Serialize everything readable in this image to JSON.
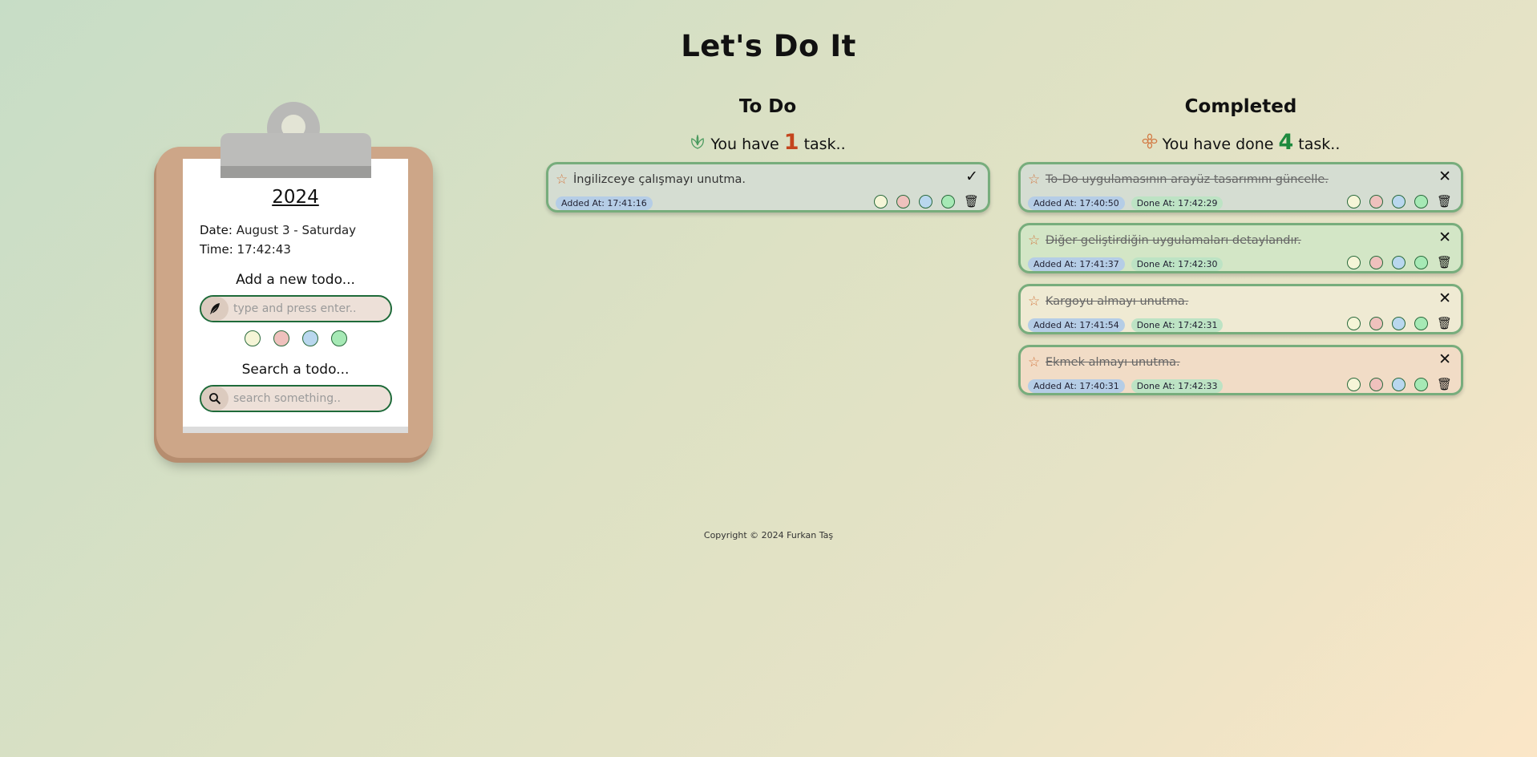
{
  "page": {
    "title": "Let's Do It"
  },
  "sidebar": {
    "year": "2024",
    "date_label": "Date:",
    "date_value": "August 3 - Saturday",
    "time_label": "Time:",
    "time_value": "17:42:43",
    "add_label": "Add a new todo...",
    "add_placeholder": "type and press enter..",
    "add_icon": "feather-icon",
    "color_options": [
      "#f5f5d7",
      "#efc1bd",
      "#b9d7ee",
      "#a6e9b5"
    ],
    "search_label": "Search a todo...",
    "search_placeholder": "search something..",
    "search_icon": "search-icon"
  },
  "todo": {
    "title": "To Do",
    "count_prefix": "You have",
    "count": "1",
    "count_suffix": "task..",
    "icon": "leaf-icon",
    "items": [
      {
        "text": "İngilizceye çalışmayı unutma.",
        "added": "Added At: 17:41:16",
        "bg": "#d5ddd2"
      }
    ]
  },
  "completed": {
    "title": "Completed",
    "count_prefix": "You have done",
    "count": "4",
    "count_suffix": "task..",
    "icon": "flower-icon",
    "items": [
      {
        "text": "To-Do uygulamasının arayüz tasarımını güncelle.",
        "added": "Added At: 17:40:50",
        "done": "Done At: 17:42:29",
        "bg": "#d5ddd2"
      },
      {
        "text": "Diğer geliştirdiğin uygulamaları detaylandır.",
        "added": "Added At: 17:41:37",
        "done": "Done At: 17:42:30",
        "bg": "#d3e6c6"
      },
      {
        "text": "Kargoyu almayı unutma.",
        "added": "Added At: 17:41:54",
        "done": "Done At: 17:42:31",
        "bg": "#efead3"
      },
      {
        "text": "Ekmek almayı unutma.",
        "added": "Added At: 17:40:31",
        "done": "Done At: 17:42:33",
        "bg": "#f1dcc6"
      }
    ]
  },
  "card_colors": [
    "#f5f5d7",
    "#efc1bd",
    "#b9d7ee",
    "#a6e9b5"
  ],
  "footer": {
    "text": "Copyright © 2024 Furkan Taş"
  }
}
